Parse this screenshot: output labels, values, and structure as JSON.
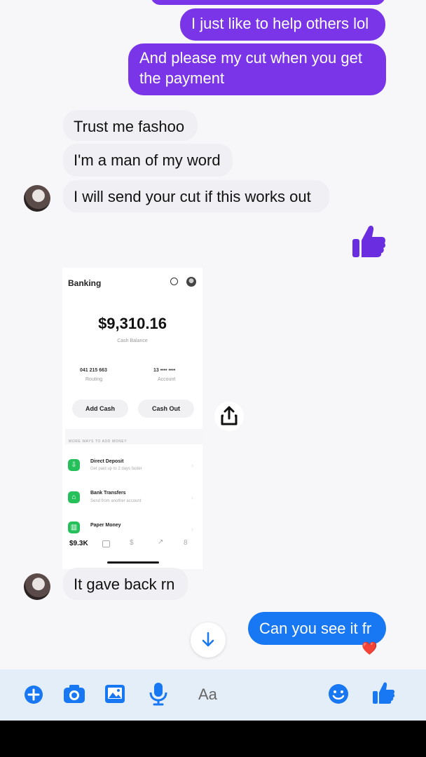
{
  "messages": {
    "m1": "I just like to help others lol",
    "m2": "And please my cut when you get the payment",
    "m3": "Trust me fashoo",
    "m4": "I'm a man of my word",
    "m5": "I will send your cut if this works out",
    "m6": "It gave back rn",
    "m7": "Can you see it fr"
  },
  "reaction": "❤️",
  "shared_screenshot": {
    "header": "Banking",
    "balance": "$9,310.16",
    "balance_caption": "Cash Balance",
    "routing_number": "041 215 663",
    "routing_label": "Routing",
    "account_number": "13 •••• ••••",
    "account_label": "Account",
    "add_cash": "Add Cash",
    "cash_out": "Cash Out",
    "section_title": "MORE WAYS TO ADD MONEY",
    "rows": [
      {
        "title": "Direct Deposit",
        "subtitle": "Get paid up to 2 days faster"
      },
      {
        "title": "Bank Transfers",
        "subtitle": "Send from another account"
      },
      {
        "title": "Paper Money",
        "subtitle": ""
      }
    ],
    "tab_balance": "$9.3K",
    "tab_dollar": "$",
    "tab_activity": "↗",
    "tab_bitcoin": "8"
  },
  "composer": {
    "placeholder": "Aa"
  },
  "colors": {
    "outgoing_bubble": "#7a35e8",
    "sent_new_bubble": "#1877f2",
    "incoming_bubble": "#f0eff3",
    "accent": "#1877f2"
  }
}
